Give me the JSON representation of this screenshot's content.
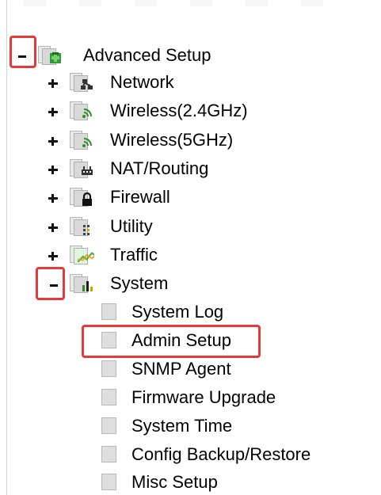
{
  "tree": {
    "root": {
      "label": "Advanced Setup",
      "icon": "folder-network-plus-icon",
      "expanded": true
    },
    "children": [
      {
        "label": "Network",
        "icon": "folder-network-icon",
        "expanded": false
      },
      {
        "label": "Wireless(2.4GHz)",
        "icon": "folder-wireless-icon",
        "expanded": false
      },
      {
        "label": "Wireless(5GHz)",
        "icon": "folder-wireless-icon",
        "expanded": false
      },
      {
        "label": "NAT/Routing",
        "icon": "folder-router-icon",
        "expanded": false
      },
      {
        "label": "Firewall",
        "icon": "folder-lock-icon",
        "expanded": false
      },
      {
        "label": "Utility",
        "icon": "folder-utility-icon",
        "expanded": false
      },
      {
        "label": "Traffic",
        "icon": "folder-chart-icon",
        "expanded": false
      },
      {
        "label": "System",
        "icon": "folder-bar-chart-icon",
        "expanded": true
      }
    ],
    "system_items": [
      {
        "label": "System Log"
      },
      {
        "label": "Admin Setup",
        "highlighted": true
      },
      {
        "label": "SNMP Agent"
      },
      {
        "label": "Firmware Upgrade"
      },
      {
        "label": "System Time"
      },
      {
        "label": "Config Backup/Restore"
      },
      {
        "label": "Misc Setup"
      }
    ]
  },
  "colors": {
    "highlight": "#e53a3a",
    "text": "#000000",
    "folder": "#d9d9d9"
  }
}
